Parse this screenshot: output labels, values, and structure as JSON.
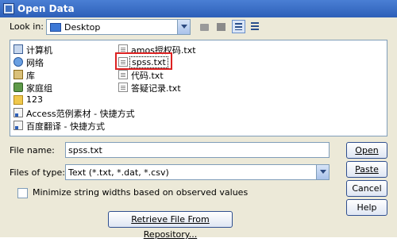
{
  "window": {
    "title": "Open Data"
  },
  "look_in": {
    "label": "Look in:",
    "value": "Desktop"
  },
  "file_list": {
    "col1": [
      {
        "name": "计算机",
        "icon": "computer-icon"
      },
      {
        "name": "网络",
        "icon": "network-icon"
      },
      {
        "name": "库",
        "icon": "library-icon"
      },
      {
        "name": "家庭组",
        "icon": "homegroup-icon"
      },
      {
        "name": "123",
        "icon": "folder-icon"
      },
      {
        "name": "Access范例素材 - 快捷方式",
        "icon": "shortcut-icon"
      },
      {
        "name": "百度翻译 - 快捷方式",
        "icon": "shortcut-icon"
      }
    ],
    "col2": [
      {
        "name": "amos授权码.txt",
        "icon": "text-file-icon"
      },
      {
        "name": "spss.txt",
        "icon": "text-file-icon"
      },
      {
        "name": "代码.txt",
        "icon": "text-file-icon"
      },
      {
        "name": "答疑记录.txt",
        "icon": "text-file-icon"
      }
    ],
    "selected": "spss.txt",
    "highlight_color": "#dd2222"
  },
  "file_name": {
    "label": "File name:",
    "value": "spss.txt"
  },
  "file_type": {
    "label": "Files of type:",
    "value": "Text (*.txt, *.dat, *.csv)"
  },
  "minimize_option": {
    "label": "Minimize string widths based on observed values",
    "checked": false
  },
  "buttons": {
    "open": "Open",
    "paste": "Paste",
    "cancel": "Cancel",
    "help": "Help",
    "retrieve": "Retrieve File From Repository..."
  },
  "colors": {
    "title_bar": "#2d5fb8",
    "dialog_bg": "#ece9d8",
    "border": "#7f9db9"
  }
}
